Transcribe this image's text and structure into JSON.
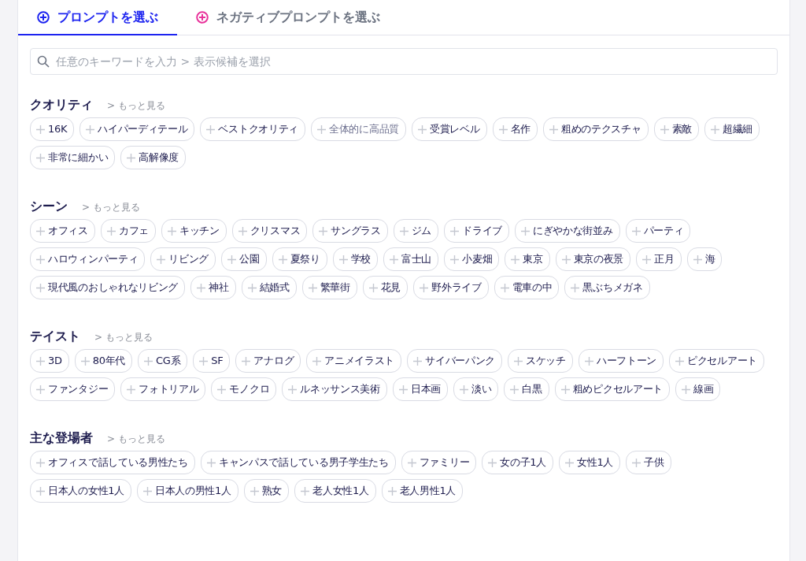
{
  "tabs": [
    {
      "label": "プロンプトを選ぶ",
      "selected": true,
      "color": "#1d24f0"
    },
    {
      "label": "ネガティブプロンプトを選ぶ",
      "selected": false,
      "color": "#e8329b"
    }
  ],
  "search": {
    "placeholder": "任意のキーワードを入力 > 表示候補を選択"
  },
  "sections": [
    {
      "title": "クオリティ",
      "more": "> もっと見る",
      "tags": [
        {
          "label": "16K",
          "disabled": false
        },
        {
          "label": "ハイパーディテール",
          "disabled": false
        },
        {
          "label": "ベストクオリティ",
          "disabled": false
        },
        {
          "label": "全体的に高品質",
          "disabled": true
        },
        {
          "label": "受賞レベル",
          "disabled": false
        },
        {
          "label": "名作",
          "disabled": false
        },
        {
          "label": "粗めのテクスチャ",
          "disabled": false
        },
        {
          "label": "素敵",
          "disabled": false
        },
        {
          "label": "超繊細",
          "disabled": false
        },
        {
          "label": "非常に細かい",
          "disabled": false
        },
        {
          "label": "高解像度",
          "disabled": false
        }
      ]
    },
    {
      "title": "シーン",
      "more": "> もっと見る",
      "tags": [
        {
          "label": "オフィス",
          "disabled": false
        },
        {
          "label": "カフェ",
          "disabled": false
        },
        {
          "label": "キッチン",
          "disabled": false
        },
        {
          "label": "クリスマス",
          "disabled": false
        },
        {
          "label": "サングラス",
          "disabled": false
        },
        {
          "label": "ジム",
          "disabled": false
        },
        {
          "label": "ドライブ",
          "disabled": false
        },
        {
          "label": "にぎやかな街並み",
          "disabled": false
        },
        {
          "label": "パーティ",
          "disabled": false
        },
        {
          "label": "ハロウィンパーティ",
          "disabled": false
        },
        {
          "label": "リビング",
          "disabled": false
        },
        {
          "label": "公園",
          "disabled": false
        },
        {
          "label": "夏祭り",
          "disabled": false
        },
        {
          "label": "学校",
          "disabled": false
        },
        {
          "label": "富士山",
          "disabled": false
        },
        {
          "label": "小麦畑",
          "disabled": false
        },
        {
          "label": "東京",
          "disabled": false
        },
        {
          "label": "東京の夜景",
          "disabled": false
        },
        {
          "label": "正月",
          "disabled": false
        },
        {
          "label": "海",
          "disabled": false
        },
        {
          "label": "現代風のおしゃれなリビング",
          "disabled": false
        },
        {
          "label": "神社",
          "disabled": false
        },
        {
          "label": "結婚式",
          "disabled": false
        },
        {
          "label": "繁華街",
          "disabled": false
        },
        {
          "label": "花見",
          "disabled": false
        },
        {
          "label": "野外ライブ",
          "disabled": false
        },
        {
          "label": "電車の中",
          "disabled": false
        },
        {
          "label": "黒ぶちメガネ",
          "disabled": false
        }
      ]
    },
    {
      "title": "テイスト",
      "more": "> もっと見る",
      "tags": [
        {
          "label": "3D",
          "disabled": false
        },
        {
          "label": "80年代",
          "disabled": false
        },
        {
          "label": "CG系",
          "disabled": false
        },
        {
          "label": "SF",
          "disabled": false
        },
        {
          "label": "アナログ",
          "disabled": false
        },
        {
          "label": "アニメイラスト",
          "disabled": false
        },
        {
          "label": "サイバーパンク",
          "disabled": false
        },
        {
          "label": "スケッチ",
          "disabled": false
        },
        {
          "label": "ハーフトーン",
          "disabled": false
        },
        {
          "label": "ピクセルアート",
          "disabled": false
        },
        {
          "label": "ファンタジー",
          "disabled": false
        },
        {
          "label": "フォトリアル",
          "disabled": false
        },
        {
          "label": "モノクロ",
          "disabled": false
        },
        {
          "label": "ルネッサンス美術",
          "disabled": false
        },
        {
          "label": "日本画",
          "disabled": false
        },
        {
          "label": "淡い",
          "disabled": false
        },
        {
          "label": "白黒",
          "disabled": false
        },
        {
          "label": "粗めピクセルアート",
          "disabled": false
        },
        {
          "label": "線画",
          "disabled": false
        }
      ]
    },
    {
      "title": "主な登場者",
      "more": "> もっと見る",
      "tags": [
        {
          "label": "オフィスで話している男性たち",
          "disabled": false
        },
        {
          "label": "キャンパスで話している男子学生たち",
          "disabled": false
        },
        {
          "label": "ファミリー",
          "disabled": false
        },
        {
          "label": "女の子1人",
          "disabled": false
        },
        {
          "label": "女性1人",
          "disabled": false
        },
        {
          "label": "子供",
          "disabled": false
        },
        {
          "label": "日本人の女性1人",
          "disabled": false
        },
        {
          "label": "日本人の男性1人",
          "disabled": false
        },
        {
          "label": "熟女",
          "disabled": false
        },
        {
          "label": "老人女性1人",
          "disabled": false
        },
        {
          "label": "老人男性1人",
          "disabled": false
        }
      ]
    }
  ]
}
